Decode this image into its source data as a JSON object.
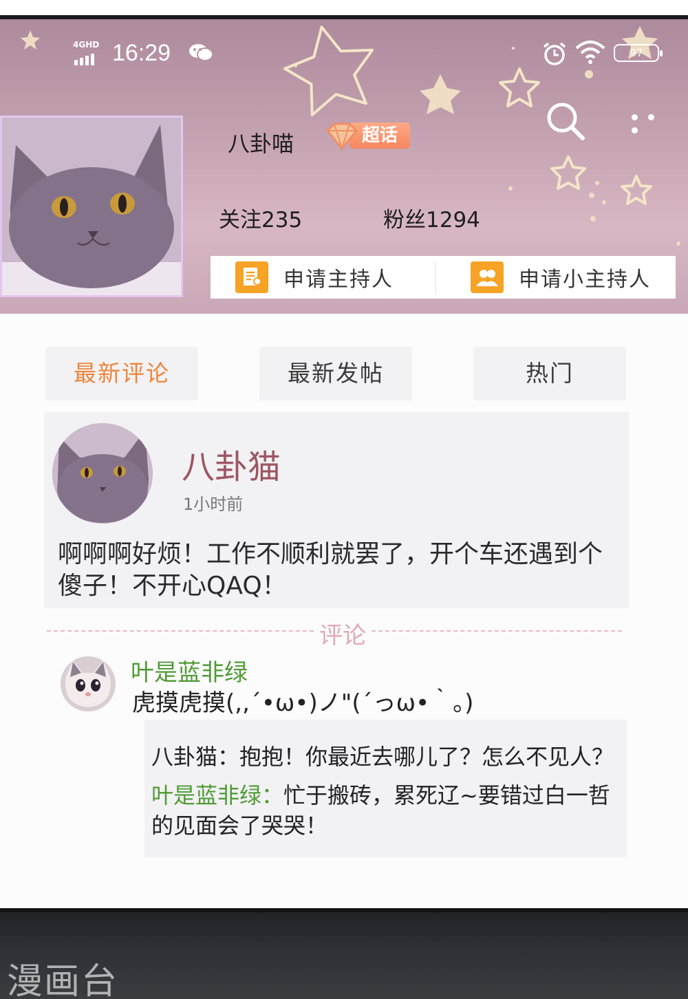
{
  "status_bar": {
    "network": "4GHD",
    "time": "16:29",
    "battery": "97",
    "icons": [
      "signal-icon",
      "wechat-icon",
      "alarm-icon",
      "wifi-icon",
      "battery-icon"
    ]
  },
  "header": {
    "username": "八卦喵",
    "badge_label": "超话",
    "follow": "关注235",
    "fans": "粉丝1294",
    "apply_host": "申请主持人",
    "apply_sub_host": "申请小主持人",
    "icons": [
      "search-icon",
      "more-icon"
    ]
  },
  "tabs": [
    {
      "label": "最新评论",
      "active": true
    },
    {
      "label": "最新发帖",
      "active": false
    },
    {
      "label": "热门",
      "active": false
    }
  ],
  "post": {
    "author": "八卦猫",
    "time": "1小时前",
    "text": "啊啊啊好烦！工作不顺利就罢了，开个车还遇到个傻子！不开心QAQ！"
  },
  "comments_divider": "评论",
  "comment": {
    "author": "叶是蓝非绿",
    "text": "虎摸虎摸(,,´•ω•)ノ\"(´っω•｀。)",
    "replies": [
      {
        "who": "八卦猫：",
        "text": "抱抱！你最近去哪儿了？怎么不见人？"
      },
      {
        "who": "叶是蓝非绿：",
        "text": "忙于搬砖，累死辽~要错过白一哲的见面会了哭哭！"
      }
    ]
  },
  "watermark": "漫画台",
  "colors": {
    "accent_orange": "#f0843a",
    "name_green": "#4f9a33",
    "author_red": "#9d5662",
    "header_pink": "#c3a1b0"
  }
}
